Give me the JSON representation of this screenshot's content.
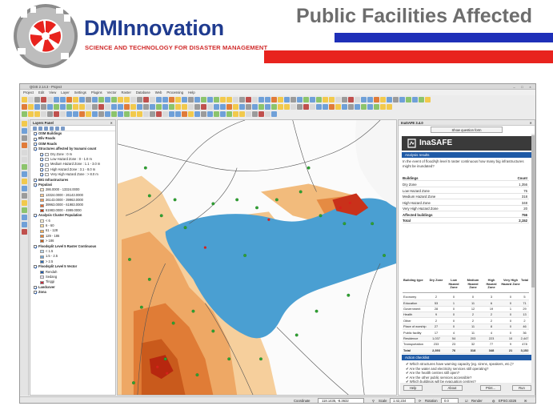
{
  "slide": {
    "brand_name": "DMInnovation",
    "brand_tagline": "SCIENCE AND TECHNOLOGY FOR DISASTER MANAGEMENT",
    "title": "Public Facilities Affected",
    "colors": {
      "blue": "#1e2fb8",
      "red": "#e8231e",
      "brand_blue": "#1f3b8f",
      "title_gray": "#6d6d6d"
    }
  },
  "qgis": {
    "window_title": "QGIS 2.14.3 - Project",
    "menu": [
      "Project",
      "Edit",
      "View",
      "Layer",
      "Settings",
      "Plugins",
      "Vector",
      "Raster",
      "Database",
      "Web",
      "Processing",
      "Help"
    ],
    "layers_panel": {
      "title": "Layers Panel",
      "items": [
        {
          "label": "OSM Buildings",
          "bold": true,
          "indent": 1,
          "checked": true,
          "swatch": ""
        },
        {
          "label": "Bliv Roads",
          "bold": true,
          "indent": 1,
          "checked": true,
          "swatch": ""
        },
        {
          "label": "OSM Roads",
          "bold": true,
          "indent": 1,
          "checked": true,
          "swatch": ""
        },
        {
          "label": "Structures affected by tsunami count",
          "bold": true,
          "indent": 1,
          "checked": true,
          "swatch": ""
        },
        {
          "label": "Dry Zone : 0 m",
          "bold": false,
          "indent": 3,
          "checked": true,
          "swatch": "#ffffff"
        },
        {
          "label": "Low Hazard Zone : 0 - 1.0 m",
          "bold": false,
          "indent": 3,
          "checked": true,
          "swatch": "#ffffff"
        },
        {
          "label": "Medium Hazard Zone : 1.1 - 3.0 m",
          "bold": false,
          "indent": 3,
          "checked": true,
          "swatch": "#ffffff"
        },
        {
          "label": "High Hazard Zone : 3.1 - 8.0 m",
          "bold": false,
          "indent": 3,
          "checked": true,
          "swatch": "#ffffff"
        },
        {
          "label": "Very High Hazard Zone : > 8.0 m",
          "bold": false,
          "indent": 3,
          "checked": true,
          "swatch": "#ffffff"
        },
        {
          "label": "BIG Infrastructures",
          "bold": true,
          "indent": 1,
          "checked": true,
          "swatch": ""
        },
        {
          "label": "Populasi",
          "bold": true,
          "indent": 1,
          "checked": true,
          "swatch": ""
        },
        {
          "label": "286.0000 - 13324.0000",
          "bold": false,
          "indent": 3,
          "checked": false,
          "swatch": "#fde7c9"
        },
        {
          "label": "13324.0000 - 26143.0000",
          "bold": false,
          "indent": 3,
          "checked": false,
          "swatch": "#f9c58f"
        },
        {
          "label": "26143.0000 - 39963.0000",
          "bold": false,
          "indent": 3,
          "checked": false,
          "swatch": "#f39b55"
        },
        {
          "label": "39963.0000 - 61983.0000",
          "bold": false,
          "indent": 3,
          "checked": false,
          "swatch": "#e4662a"
        },
        {
          "label": "61983.0000 - 4999.0000",
          "bold": false,
          "indent": 3,
          "checked": false,
          "swatch": "#c03b12"
        },
        {
          "label": "Analysis Cluster Population",
          "bold": true,
          "indent": 1,
          "checked": true,
          "swatch": ""
        },
        {
          "label": "< 6",
          "bold": false,
          "indent": 3,
          "checked": false,
          "swatch": "#fff4d6"
        },
        {
          "label": "6 - 60",
          "bold": false,
          "indent": 3,
          "checked": false,
          "swatch": "#fddc9a"
        },
        {
          "label": "61 - 128",
          "bold": false,
          "indent": 3,
          "checked": false,
          "swatch": "#f6b15a"
        },
        {
          "label": "129 - 186",
          "bold": false,
          "indent": 3,
          "checked": false,
          "swatch": "#e88330"
        },
        {
          "label": "> 186",
          "bold": false,
          "indent": 3,
          "checked": false,
          "swatch": "#c75a14"
        },
        {
          "label": "Floodsplit Level 5 Raster Continuous",
          "bold": true,
          "indent": 1,
          "checked": true,
          "swatch": ""
        },
        {
          "label": "< 1.5",
          "bold": false,
          "indent": 3,
          "checked": false,
          "swatch": "#b9d7ef"
        },
        {
          "label": "1.5 - 2.5",
          "bold": false,
          "indent": 3,
          "checked": false,
          "swatch": "#6fa7d8"
        },
        {
          "label": "> 2.5",
          "bold": false,
          "indent": 3,
          "checked": false,
          "swatch": "#2d6bb3"
        },
        {
          "label": "Floodsplit Level 5 Vector",
          "bold": true,
          "indent": 1,
          "checked": true,
          "swatch": ""
        },
        {
          "label": "Rendah",
          "bold": false,
          "indent": 3,
          "checked": false,
          "swatch": "#1b57a8"
        },
        {
          "label": "Sedang",
          "bold": false,
          "indent": 3,
          "checked": false,
          "swatch": "#e8e0f3"
        },
        {
          "label": "Tinggi",
          "bold": false,
          "indent": 3,
          "checked": false,
          "swatch": "#c4283b"
        },
        {
          "label": "Landcover",
          "bold": true,
          "indent": 1,
          "checked": true,
          "swatch": ""
        },
        {
          "label": "Zona",
          "bold": true,
          "indent": 1,
          "checked": true,
          "swatch": ""
        }
      ]
    },
    "inasafe": {
      "dock_title": "InaSAFE 3.4.0",
      "show_question_button": "Show question form",
      "logo_text": "InaSAFE",
      "results_heading": "Analysis results",
      "question": "In the event of flood/sjh level 5 raster continuous how many big infrastructures might be inundated?",
      "summary_header": {
        "label": "Buildings",
        "value": "Count"
      },
      "summary": [
        {
          "label": "Dry Zone",
          "value": "1,356",
          "bold": false
        },
        {
          "label": "Low Hazard Zone",
          "value": "76",
          "bold": false
        },
        {
          "label": "Medium Hazard Zone",
          "value": "318",
          "bold": false
        },
        {
          "label": "High Hazard Zone",
          "value": "348",
          "bold": false
        },
        {
          "label": "Very High Hazard Zone",
          "value": "20",
          "bold": false
        },
        {
          "label": "Affected buildings",
          "value": "756",
          "bold": true
        },
        {
          "label": "Total",
          "value": "2,152",
          "bold": true
        }
      ],
      "breakdown_columns": [
        "Building type",
        "Dry Zone",
        "Low Hazard Zone",
        "Medium Hazard Zone",
        "High Hazard Zone",
        "Very High Hazard Zone",
        "Total"
      ],
      "breakdown_rows": [
        {
          "cells": [
            "Economy",
            "2",
            "0",
            "0",
            "3",
            "0",
            "5"
          ],
          "bold": false
        },
        {
          "cells": [
            "Education",
            "53",
            "1",
            "11",
            "6",
            "0",
            "71"
          ],
          "bold": false
        },
        {
          "cells": [
            "Government",
            "28",
            "0",
            "12",
            "19",
            "1",
            "29"
          ],
          "bold": false
        },
        {
          "cells": [
            "Health",
            "9",
            "0",
            "2",
            "2",
            "0",
            "13"
          ],
          "bold": false
        },
        {
          "cells": [
            "Other",
            "2",
            "0",
            "2",
            "2",
            "0",
            "2"
          ],
          "bold": false
        },
        {
          "cells": [
            "Place of worship",
            "27",
            "0",
            "11",
            "8",
            "0",
            "46"
          ],
          "bold": false
        },
        {
          "cells": [
            "Public facility",
            "17",
            "4",
            "11",
            "4",
            "0",
            "36"
          ],
          "bold": false
        },
        {
          "cells": [
            "Residence",
            "1,037",
            "54",
            "203",
            "223",
            "10",
            "2,447"
          ],
          "bold": false
        },
        {
          "cells": [
            "Transportation",
            "233",
            "23",
            "32",
            "77",
            "9",
            "478"
          ],
          "bold": false
        },
        {
          "cells": [
            "Total",
            "2,393",
            "76",
            "318",
            "348",
            "21",
            "3,152"
          ],
          "bold": true
        }
      ],
      "action_heading": "Action checklist",
      "actions": [
        "✔ Which structures have warning capacity (eg. sirens, speakers, etc.)?",
        "✔ Are the water and electricity services still operating?",
        "✔ Are the health centres still open?",
        "✔ Are the other public services accessible?",
        "✔ Which buildings will be evacuation centres?"
      ],
      "buttons": {
        "help": "Help",
        "about": "About",
        "print": "Print...",
        "run": "Run"
      }
    },
    "statusbar": {
      "coordinate_label": "Coordinate",
      "coordinate": "118.1435, -8.3632",
      "scale_label": "Scale",
      "scale": "1:42,234",
      "rotation_label": "Rotation",
      "rotation": "0.0",
      "render_label": "Render",
      "crs": "EPSG:4326"
    }
  }
}
